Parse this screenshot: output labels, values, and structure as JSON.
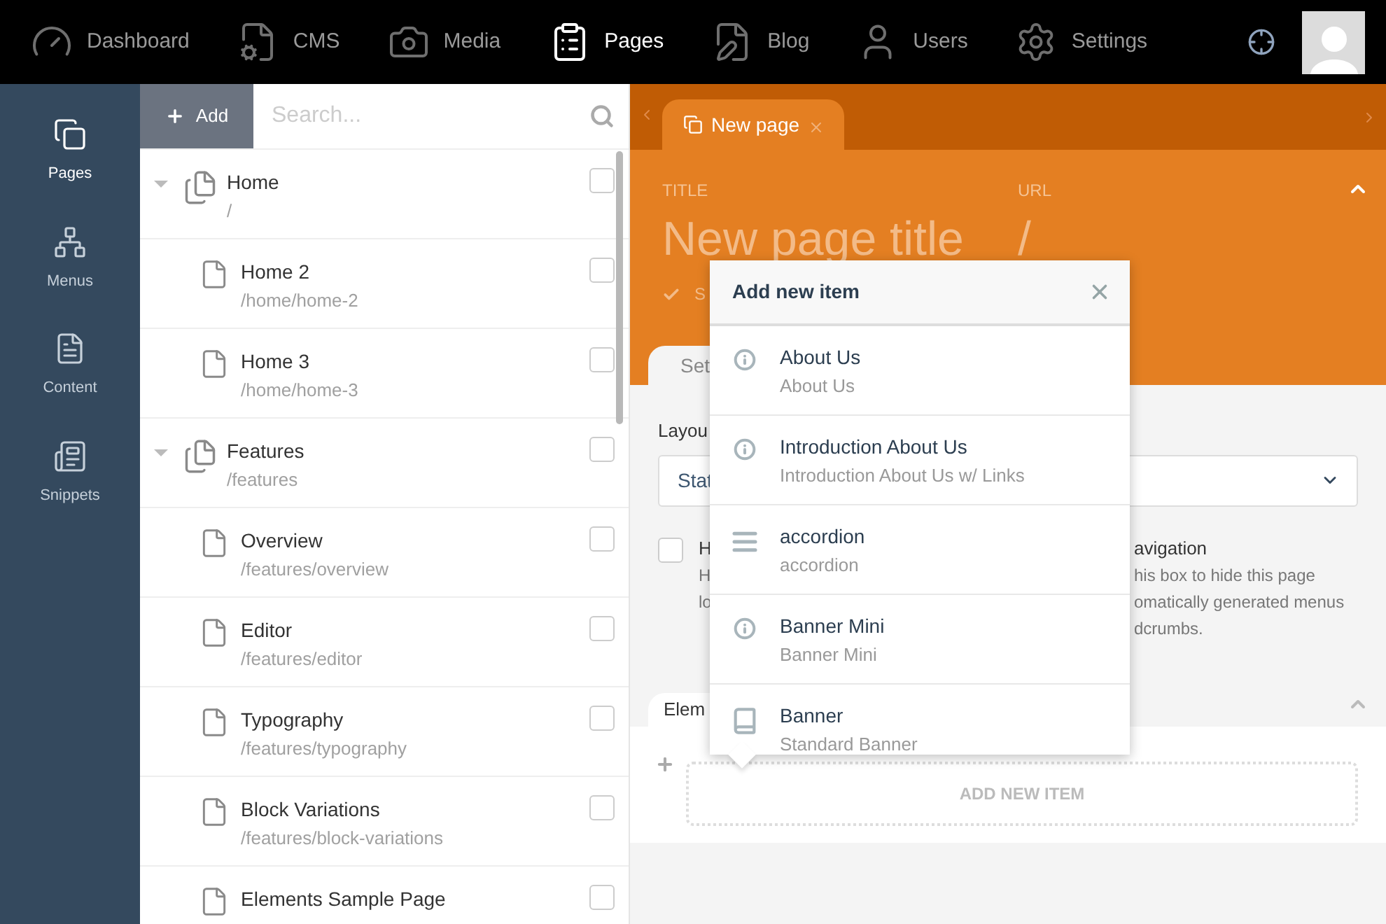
{
  "top_nav": {
    "items": [
      {
        "label": "Dashboard",
        "selected": false
      },
      {
        "label": "CMS",
        "selected": false
      },
      {
        "label": "Media",
        "selected": false
      },
      {
        "label": "Pages",
        "selected": true
      },
      {
        "label": "Blog",
        "selected": false
      },
      {
        "label": "Users",
        "selected": false
      },
      {
        "label": "Settings",
        "selected": false
      }
    ]
  },
  "sidebar": {
    "items": [
      {
        "label": "Pages",
        "selected": true
      },
      {
        "label": "Menus",
        "selected": false
      },
      {
        "label": "Content",
        "selected": false
      },
      {
        "label": "Snippets",
        "selected": false
      }
    ]
  },
  "tree_toolbar": {
    "add_button": "Add",
    "search": {
      "placeholder": "Search..."
    }
  },
  "tree": [
    {
      "title": "Home",
      "path": "/",
      "checked": false,
      "expanded": true,
      "children": [
        {
          "title": "Home 2",
          "path": "/home/home-2",
          "checked": false
        },
        {
          "title": "Home 3",
          "path": "/home/home-3",
          "checked": false
        }
      ]
    },
    {
      "title": "Features",
      "path": "/features",
      "checked": false,
      "expanded": true,
      "children": [
        {
          "title": "Overview",
          "path": "/features/overview",
          "checked": false
        },
        {
          "title": "Editor",
          "path": "/features/editor",
          "checked": false
        },
        {
          "title": "Typography",
          "path": "/features/typography",
          "checked": false
        },
        {
          "title": "Block Variations",
          "path": "/features/block-variations",
          "checked": false
        },
        {
          "title": "Elements Sample Page",
          "checked": false
        }
      ]
    }
  ],
  "editor_tabs": [
    {
      "label": "New page",
      "selected": true
    }
  ],
  "page_header": {
    "title_label": "TITLE",
    "title_placeholder": "New page title",
    "url_label": "URL",
    "url_value": "/",
    "status_text": "S"
  },
  "settings_tabs": [
    {
      "label": "Set",
      "selected": true
    }
  ],
  "settings": {
    "layout_label": "Layou",
    "layout_value": "Stat",
    "hide_checkbox": {
      "checked": false,
      "label_left": "H",
      "label_right": "avigation",
      "help_left": [
        "H",
        "lo"
      ],
      "help_right": [
        "his box to hide this page",
        "omatically generated menus",
        "dcrumbs."
      ]
    }
  },
  "elements_tabs": [
    {
      "label": "Elem",
      "selected": true
    }
  ],
  "add_new_item": "ADD NEW ITEM",
  "modal": {
    "title": "Add new item",
    "items": [
      {
        "kind": "info",
        "title": "About Us",
        "subtitle": "About Us"
      },
      {
        "kind": "info",
        "title": "Introduction About Us",
        "subtitle": "Introduction About Us w/ Links"
      },
      {
        "kind": "list",
        "title": "accordion",
        "subtitle": "accordion"
      },
      {
        "kind": "info",
        "title": "Banner Mini",
        "subtitle": "Banner Mini"
      },
      {
        "kind": "book",
        "title": "Banner",
        "subtitle": "Standard Banner"
      }
    ]
  }
}
